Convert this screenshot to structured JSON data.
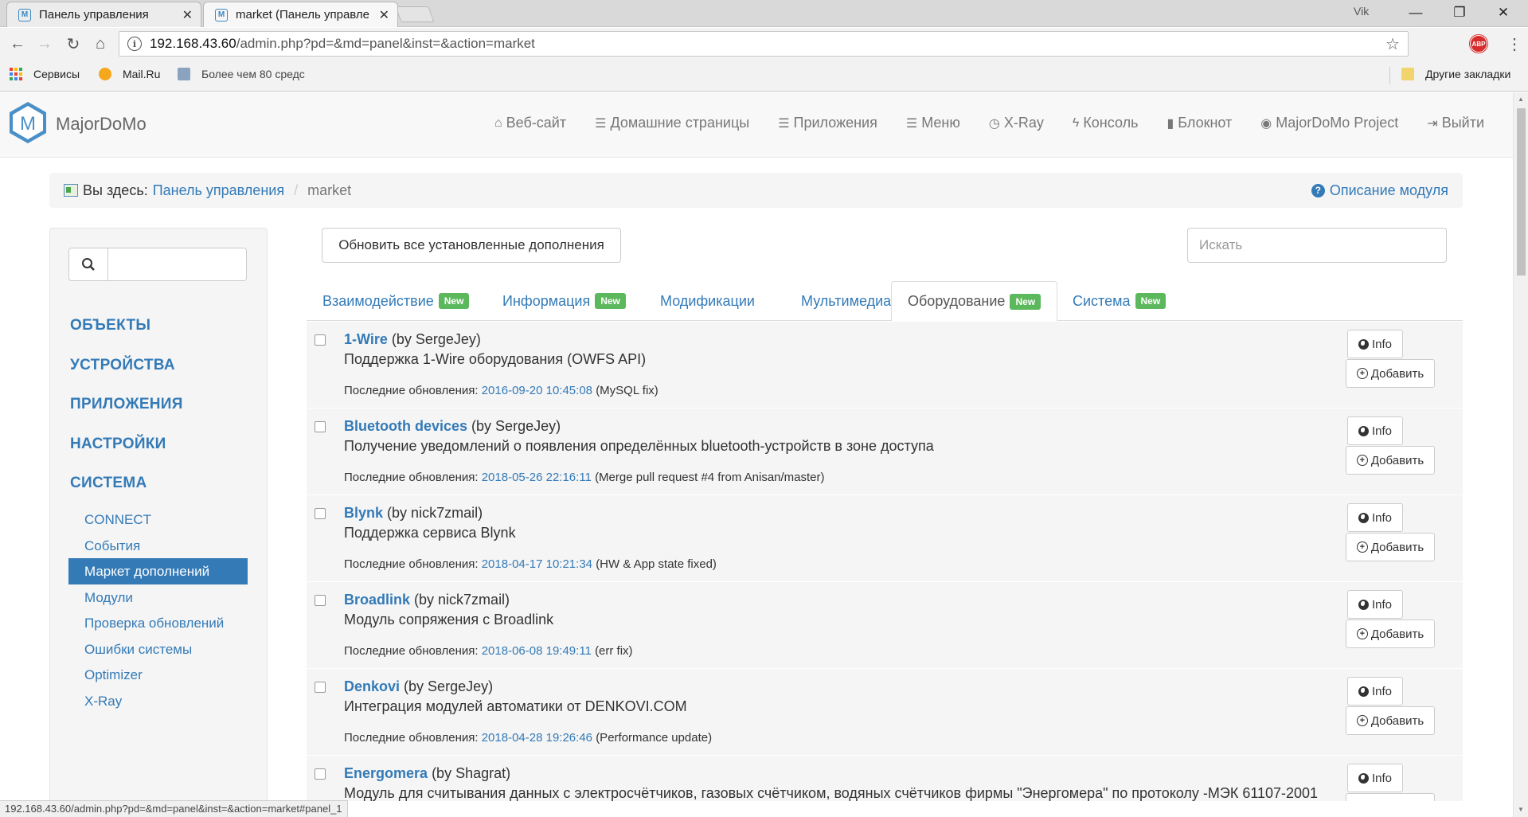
{
  "browser": {
    "tabs": [
      {
        "title": "Панель управления",
        "active": false
      },
      {
        "title": "market (Панель управле",
        "active": true
      }
    ],
    "user": "Vik",
    "window_controls": [
      "minimize-icon",
      "maximize-icon",
      "close-icon"
    ],
    "url": {
      "host": "192.168.43.60",
      "path": "/admin.php?pd=&md=panel&inst=&action=market"
    },
    "bookmarks": [
      {
        "label": "Сервисы",
        "icon": "apps-icon"
      },
      {
        "label": "Mail.Ru",
        "icon": "mailru-icon"
      },
      {
        "label": "Более чем 80 средс",
        "icon": "bookmark-h-icon"
      }
    ],
    "other_bookmarks": "Другие закладки",
    "status_url": "192.168.43.60/admin.php?pd=&md=panel&inst=&action=market#panel_1"
  },
  "site": {
    "brand": "MajorDoMo",
    "nav": [
      {
        "label": "Веб-сайт",
        "icon": "home-icon"
      },
      {
        "label": "Домашние страницы",
        "icon": "list-icon"
      },
      {
        "label": "Приложения",
        "icon": "list-icon"
      },
      {
        "label": "Меню",
        "icon": "list-icon"
      },
      {
        "label": "X-Ray",
        "icon": "dashboard-icon"
      },
      {
        "label": "Консоль",
        "icon": "flash-icon"
      },
      {
        "label": "Блокнот",
        "icon": "book-icon"
      },
      {
        "label": "MajorDoMo Project",
        "icon": "globe-icon"
      },
      {
        "label": "Выйти",
        "icon": "logout-icon"
      }
    ]
  },
  "breadcrumb": {
    "here": "Вы здесь:",
    "parent": "Панель управления",
    "current": "market",
    "help": "Описание модуля"
  },
  "sidebar": {
    "categories": [
      "ОБЪЕКТЫ",
      "УСТРОЙСТВА",
      "ПРИЛОЖЕНИЯ",
      "НАСТРОЙКИ",
      "СИСТЕМА"
    ],
    "items": [
      {
        "label": "CONNECT",
        "active": false
      },
      {
        "label": "События",
        "active": false
      },
      {
        "label": "Маркет дополнений",
        "active": true
      },
      {
        "label": "Модули",
        "active": false
      },
      {
        "label": "Проверка обновлений",
        "active": false
      },
      {
        "label": "Ошибки системы",
        "active": false
      },
      {
        "label": "Optimizer",
        "active": false
      },
      {
        "label": "X-Ray",
        "active": false
      }
    ]
  },
  "main": {
    "update_button": "Обновить все установленные дополнения",
    "search_placeholder": "Искать",
    "tabs": [
      {
        "label": "Взаимодействие",
        "badge": "New",
        "active": false
      },
      {
        "label": "Информация",
        "badge": "New",
        "active": false
      },
      {
        "label": "Модификации",
        "badge": "",
        "active": false
      },
      {
        "label": "Мультимедиа",
        "badge": "",
        "active": false
      },
      {
        "label": "Оборудование",
        "badge": "New",
        "active": true
      },
      {
        "label": "Система",
        "badge": "New",
        "active": false
      }
    ],
    "updated_label": "Последние обновления:",
    "info_label": "Info",
    "add_label": "Добавить",
    "modules": [
      {
        "name": "1-Wire",
        "by": "(by SergeJey)",
        "desc": "Поддержка 1-Wire оборудования (OWFS API)",
        "date": "2016-09-20 10:45:08",
        "note": "(MySQL fix)"
      },
      {
        "name": "Bluetooth devices",
        "by": "(by SergeJey)",
        "desc": "Получение уведомлений о появления определённых bluetooth-устройств в зоне доступа",
        "date": "2018-05-26 22:16:11",
        "note": "(Merge pull request #4 from Anisan/master)"
      },
      {
        "name": "Blynk",
        "by": "(by nick7zmail)",
        "desc": "Поддержка сервиса Blynk",
        "date": "2018-04-17 10:21:34",
        "note": "(HW & App state fixed)"
      },
      {
        "name": "Broadlink",
        "by": "(by nick7zmail)",
        "desc": "Модуль сопряжения с Broadlink",
        "date": "2018-06-08 19:49:11",
        "note": "(err fix)"
      },
      {
        "name": "Denkovi",
        "by": "(by SergeJey)",
        "desc": "Интеграция модулей автоматики от DENKOVI.COM",
        "date": "2018-04-28 19:26:46",
        "note": "(Performance update)"
      },
      {
        "name": "Energomera",
        "by": "(by Shagrat)",
        "desc": "Модуль для считывания данных с электросчётчиков, газовых счётчиком, водяных счётчиков фирмы \"Энергомера\" по протоколу -МЭК 61107-2001",
        "date": "",
        "note": ""
      }
    ]
  },
  "colors": {
    "link": "#337ab7",
    "badge": "#5cb85c",
    "active_item": "#337ab7"
  }
}
